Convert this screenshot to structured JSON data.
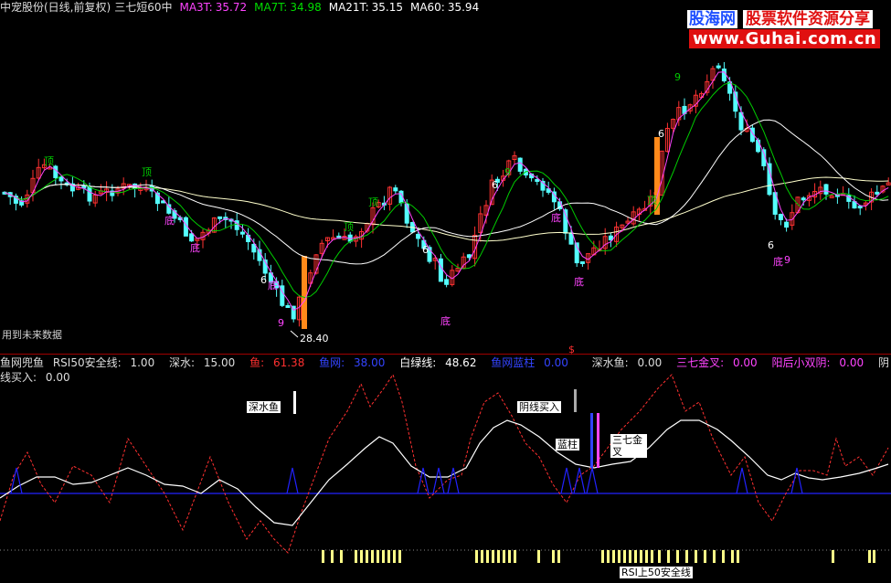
{
  "header": {
    "title": "中宠股份(日线,前复权)",
    "indicator_name": "三七短60中",
    "ma3_label": "MA3T:",
    "ma3_value": "35.72",
    "ma7_label": "MA7T:",
    "ma7_value": "34.98",
    "ma21_label": "MA21T:",
    "ma21_value": "35.15",
    "ma60_label": "MA60:",
    "ma60_value": "35.94"
  },
  "watermark": {
    "brand": "股海网",
    "slogan": "股票软件资源分享",
    "url": "www.Guhai.com.cn"
  },
  "upper_annotations": {
    "future_data": "用到未来数据",
    "low_price": "28.40",
    "top_label": "顶",
    "bottom_label": "底",
    "six": "6",
    "nine": "9",
    "dollar": "$"
  },
  "indicator_header": {
    "name": "鱼网兜鱼",
    "rsi_label": "RSI50安全线:",
    "rsi_value": "1.00",
    "deep_label": "深水:",
    "deep_value": "15.00",
    "fish_label": "鱼:",
    "fish_value": "61.38",
    "net_label": "鱼网:",
    "net_value": "38.00",
    "white_label": "白绿线:",
    "white_value": "48.62",
    "bluebar_label": "鱼网蓝柱",
    "bluebar_value": "0.00",
    "deepfish_label": "深水鱼:",
    "deepfish_value": "0.00",
    "golden_label": "三七金叉:",
    "golden_value": "0.00",
    "double_label": "阳后小双阴:",
    "double_value": "0.00",
    "yinbuy_label": "阴线买入:",
    "yinbuy_value": "0.00"
  },
  "lower_annotations": {
    "deep_fish": "深水鱼",
    "yin_buy": "阴线买入",
    "blue_bar": "蓝柱",
    "golden_cross": "三七金叉",
    "rsi_safe": "RSI上50安全线"
  },
  "colors": {
    "up_candle": "#ff3232",
    "down_candle": "#54ffff",
    "ma_white": "#ffffff",
    "ma_green": "#00dd00",
    "ma_yellow": "#ffff99",
    "fish_red": "#ff3030",
    "net_blue": "#2222ff",
    "label_magenta": "#ff44ff"
  }
}
